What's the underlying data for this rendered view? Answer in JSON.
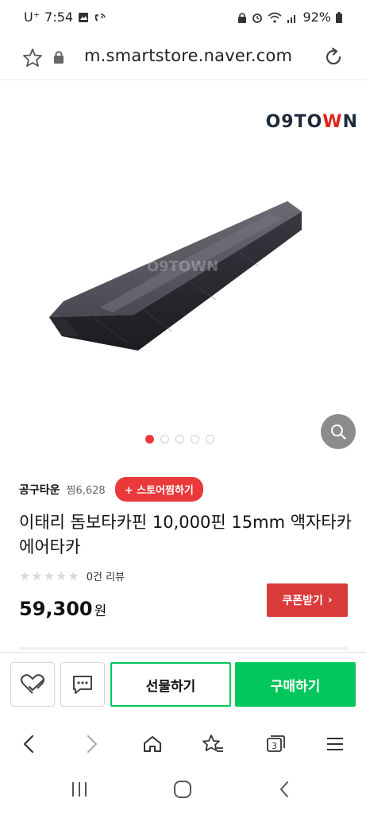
{
  "status_bar": {
    "carrier": "U⁺",
    "time": "7:54",
    "battery": "92%"
  },
  "browser": {
    "url": "m.smartstore.naver.com"
  },
  "product": {
    "brand_logo_prefix": "O9TO",
    "brand_logo_red": "W",
    "brand_logo_suffix": "N",
    "watermark": "O9TOWN",
    "image_index": 1,
    "image_count": 5
  },
  "store": {
    "name": "공구타운",
    "likes": "찜6,628",
    "favorite_label": "+ 스토어찜하기"
  },
  "title": "이태리 돔보타카핀 10,000핀 15mm 액자타카 에어타카",
  "review": {
    "stars": "★★★★★",
    "count_label": "0건 리뷰",
    "rating": 0
  },
  "price": {
    "amount": "59,300",
    "unit": "원"
  },
  "coupon_label": "쿠폰받기",
  "coupon_chevron": "›",
  "actions": {
    "gift_label": "선물하기",
    "buy_label": "구매하기"
  },
  "browser_nav": {
    "tab_count": "3"
  },
  "colors": {
    "accent_red": "#e9393b",
    "naver_green": "#03c75a",
    "coupon_red": "#d93a3a"
  }
}
